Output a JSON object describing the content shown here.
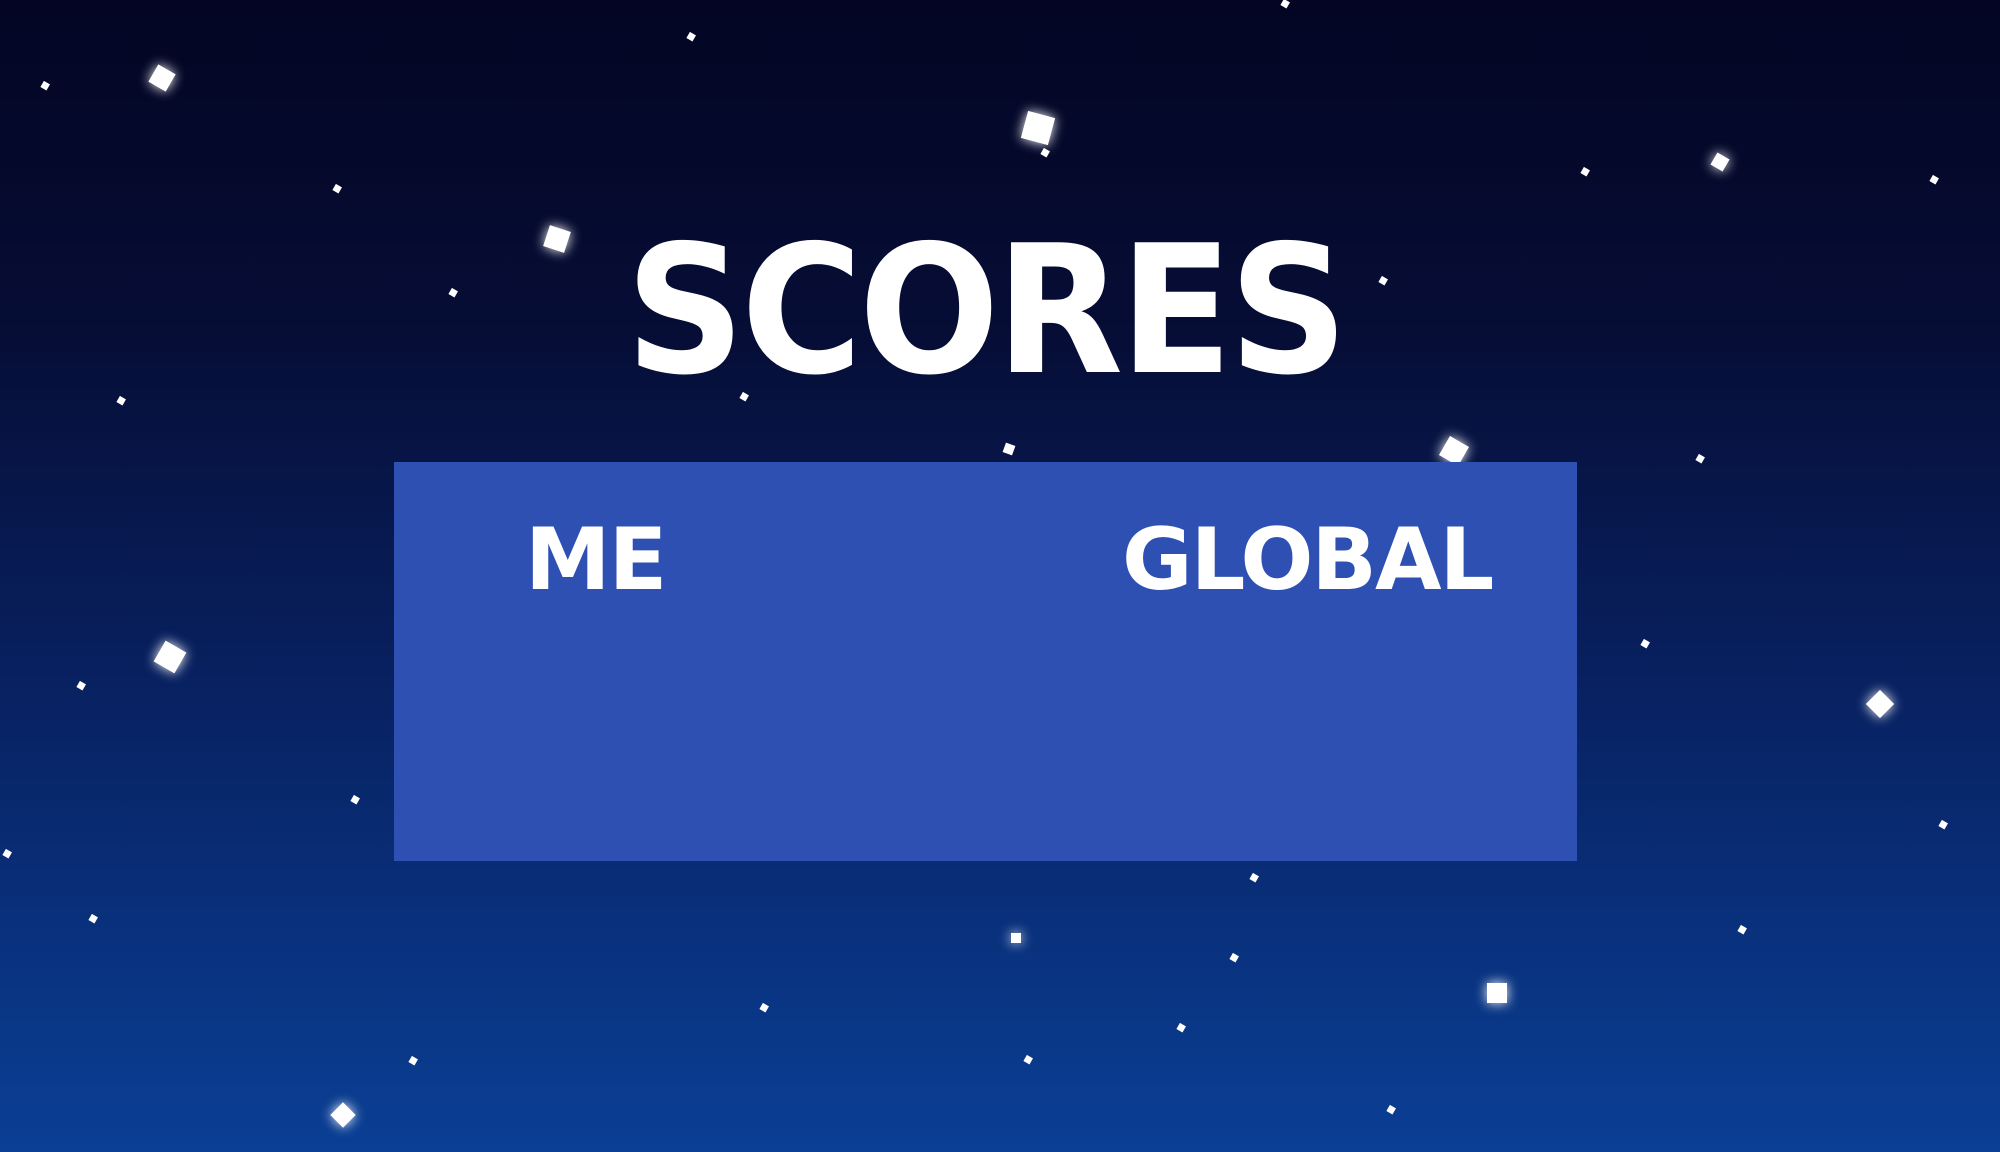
{
  "screen": {
    "title": "SCORES",
    "tabs": [
      {
        "id": "me",
        "label": "ME"
      },
      {
        "id": "global",
        "label": "GLOBAL"
      }
    ]
  },
  "colors": {
    "sky_top": "#030523",
    "sky_bottom": "#0a3f95",
    "panel": "#2d50b2",
    "text": "#ffffff",
    "star": "#ffffff"
  }
}
